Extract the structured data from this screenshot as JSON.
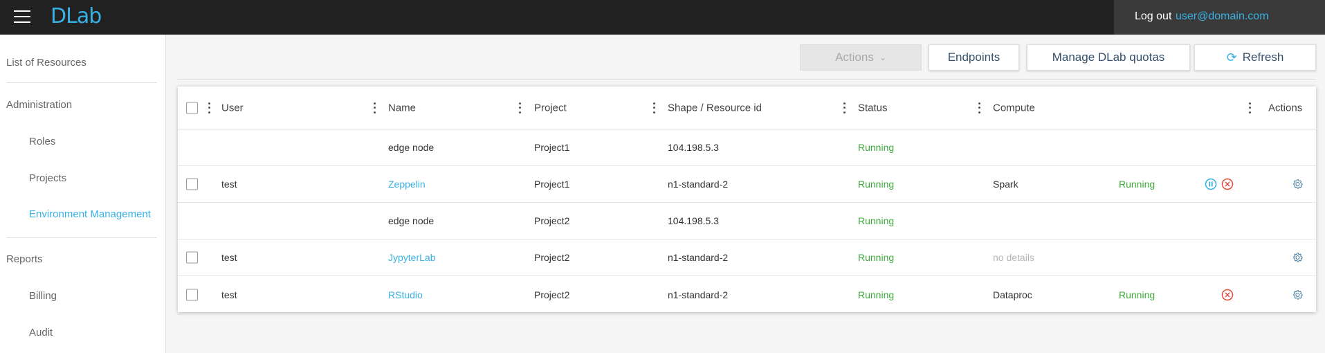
{
  "header": {
    "app_name": "DLab",
    "logout_label": "Log out",
    "user_email": "user@domain.com"
  },
  "sidebar": {
    "items": [
      {
        "label": "List of Resources"
      },
      {
        "label": "Administration"
      },
      {
        "label": "Roles"
      },
      {
        "label": "Projects"
      },
      {
        "label": "Environment Management"
      },
      {
        "label": "Reports"
      },
      {
        "label": "Billing"
      },
      {
        "label": "Audit"
      }
    ]
  },
  "toolbar": {
    "actions_label": "Actions",
    "endpoints_label": "Endpoints",
    "quotas_label": "Manage DLab quotas",
    "refresh_label": "Refresh"
  },
  "table": {
    "columns": [
      "User",
      "Name",
      "Project",
      "Shape / Resource id",
      "Status",
      "Compute",
      "Actions"
    ],
    "rows": [
      {
        "user": "",
        "name": "edge node",
        "project": "Project1",
        "shape": "104.198.5.3",
        "status": "Running",
        "compute": "",
        "compute_status": ""
      },
      {
        "user": "test",
        "name": "Zeppelin",
        "project": "Project1",
        "shape": "n1-standard-2",
        "status": "Running",
        "compute": "Spark",
        "compute_status": "Running"
      },
      {
        "user": "",
        "name": "edge node",
        "project": "Project2",
        "shape": "104.198.5.3",
        "status": "Running",
        "compute": "",
        "compute_status": ""
      },
      {
        "user": "test",
        "name": "JypyterLab",
        "project": "Project2",
        "shape": "n1-standard-2",
        "status": "Running",
        "compute": "no details",
        "compute_status": ""
      },
      {
        "user": "test",
        "name": "RStudio",
        "project": "Project2",
        "shape": "n1-standard-2",
        "status": "Running",
        "compute": "Dataproc",
        "compute_status": "Running"
      }
    ]
  },
  "colors": {
    "accent": "#39b0e3",
    "running": "#3cab3c",
    "danger": "#e64a3b",
    "topbar": "#212121"
  },
  "icons": [
    "menu-icon",
    "chevron-down-icon",
    "refresh-icon",
    "pause-icon",
    "terminate-icon",
    "gear-icon"
  ]
}
